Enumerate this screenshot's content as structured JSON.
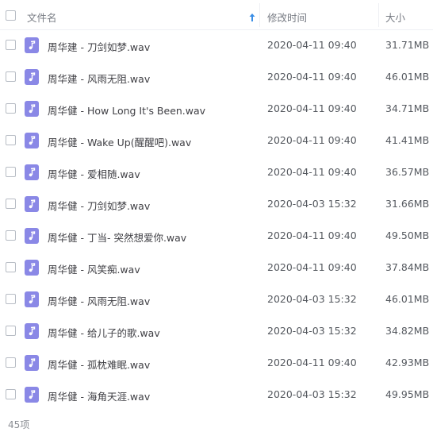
{
  "header": {
    "name_label": "文件名",
    "date_label": "修改时间",
    "size_label": "大小",
    "sort_icon": "sort-ascending-arrow-icon"
  },
  "accent_color": "#3a8ee6",
  "file_icon_color": "#8a88e6",
  "files": [
    {
      "name": "周华建 - 刀剑如梦.wav",
      "date": "2020-04-11 09:40",
      "size": "31.71MB"
    },
    {
      "name": "周华建 - 风雨无阻.wav",
      "date": "2020-04-11 09:40",
      "size": "46.01MB"
    },
    {
      "name": "周华健 - How Long It's Been.wav",
      "date": "2020-04-11 09:40",
      "size": "34.71MB"
    },
    {
      "name": "周华健 - Wake Up(醒醒吧).wav",
      "date": "2020-04-11 09:40",
      "size": "41.41MB"
    },
    {
      "name": "周华健 - 爱相随.wav",
      "date": "2020-04-11 09:40",
      "size": "36.57MB"
    },
    {
      "name": "周华健 - 刀剑如梦.wav",
      "date": "2020-04-03 15:32",
      "size": "31.66MB"
    },
    {
      "name": "周华健 - 丁当- 突然想爱你.wav",
      "date": "2020-04-11 09:40",
      "size": "49.50MB"
    },
    {
      "name": "周华健 - 风笑痴.wav",
      "date": "2020-04-11 09:40",
      "size": "37.84MB"
    },
    {
      "name": "周华健 - 风雨无阻.wav",
      "date": "2020-04-03 15:32",
      "size": "46.01MB"
    },
    {
      "name": "周华健 - 给儿子的歌.wav",
      "date": "2020-04-03 15:32",
      "size": "34.82MB"
    },
    {
      "name": "周华健 - 孤枕难眠.wav",
      "date": "2020-04-11 09:40",
      "size": "42.93MB"
    },
    {
      "name": "周华健 - 海角天涯.wav",
      "date": "2020-04-03 15:32",
      "size": "49.95MB"
    }
  ],
  "footer": {
    "count_text": "45项"
  }
}
